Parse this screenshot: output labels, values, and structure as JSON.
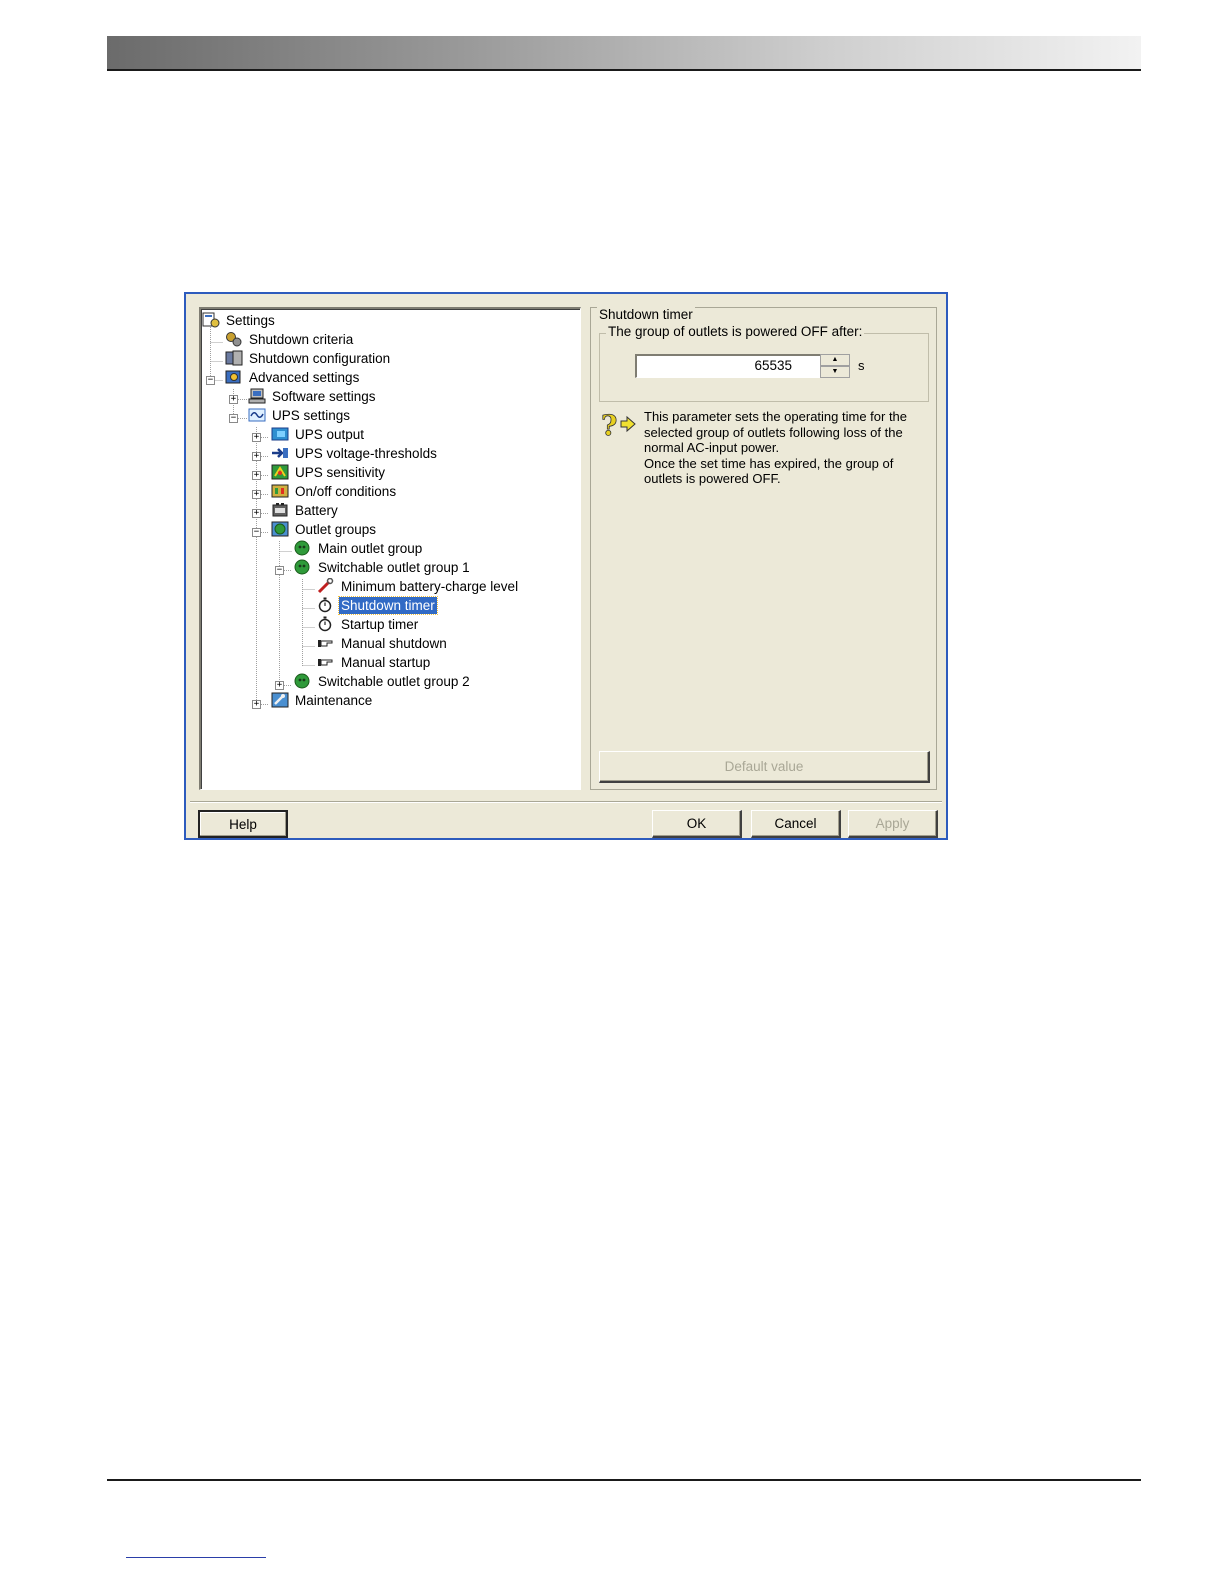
{
  "tree": {
    "items": [
      {
        "label": "Settings",
        "icon": "settings-icon"
      },
      {
        "label": "Shutdown criteria",
        "icon": "gears-icon"
      },
      {
        "label": "Shutdown configuration",
        "icon": "computer-config-icon"
      },
      {
        "label": "Advanced settings",
        "icon": "advanced-settings-icon"
      },
      {
        "label": "Software settings",
        "icon": "computer-icon"
      },
      {
        "label": "UPS settings",
        "icon": "ups-wave-icon"
      },
      {
        "label": "UPS output",
        "icon": "ups-output-icon"
      },
      {
        "label": "UPS voltage-thresholds",
        "icon": "voltage-arrow-icon"
      },
      {
        "label": "UPS sensitivity",
        "icon": "sensitivity-icon"
      },
      {
        "label": "On/off conditions",
        "icon": "on-off-icon"
      },
      {
        "label": "Battery",
        "icon": "battery-icon"
      },
      {
        "label": "Outlet groups",
        "icon": "outlet-groups-icon"
      },
      {
        "label": "Main outlet group",
        "icon": "outlet-icon"
      },
      {
        "label": "Switchable outlet group 1",
        "icon": "outlet-icon"
      },
      {
        "label": "Minimum battery-charge level",
        "icon": "wrench-icon"
      },
      {
        "label": "Shutdown timer",
        "icon": "stopwatch-icon"
      },
      {
        "label": "Startup timer",
        "icon": "stopwatch-icon"
      },
      {
        "label": "Manual shutdown",
        "icon": "hand-pointer-icon"
      },
      {
        "label": "Manual startup",
        "icon": "hand-pointer-icon"
      },
      {
        "label": "Switchable outlet group 2",
        "icon": "outlet-icon"
      },
      {
        "label": "Maintenance",
        "icon": "maintenance-icon"
      }
    ],
    "selected": "Shutdown timer"
  },
  "panel": {
    "group_title": "Shutdown timer",
    "fieldset_title": "The group of outlets is powered OFF after:",
    "value": "65535",
    "unit": "s",
    "help_text": "This parameter sets the operating time for the selected group of outlets following loss of the normal AC-input power.",
    "help_text_2": "Once the set time has expired, the group of outlets is powered OFF.",
    "default_button": "Default value"
  },
  "buttons": {
    "help": "Help",
    "ok": "OK",
    "cancel": "Cancel",
    "apply": "Apply"
  },
  "colors": {
    "dialog_border": "#2d5bbd",
    "dialog_bg": "#ece9d8",
    "selection": "#316ac5"
  }
}
